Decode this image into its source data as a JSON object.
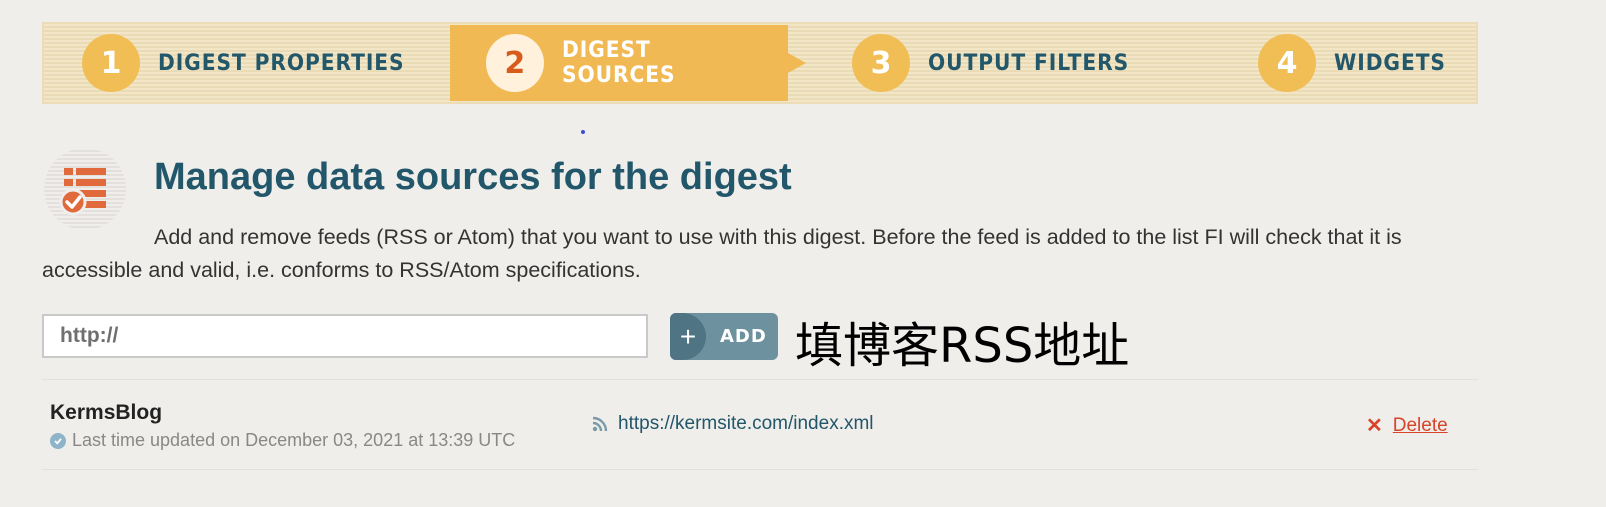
{
  "steps": [
    {
      "number": "1",
      "label": "DIGEST PROPERTIES"
    },
    {
      "number": "2",
      "label": "DIGEST SOURCES"
    },
    {
      "number": "3",
      "label": "OUTPUT FILTERS"
    },
    {
      "number": "4",
      "label": "WIDGETS"
    }
  ],
  "heading": {
    "title": "Manage data sources for the digest",
    "description": "Add and remove feeds (RSS or Atom) that you want to use with this digest. Before the feed is added to the list FI will check that it is accessible and valid, i.e. conforms to RSS/Atom specifications."
  },
  "add_form": {
    "placeholder": "http://",
    "value": "",
    "button_label": "ADD",
    "annotation": "填博客RSS地址"
  },
  "feeds": [
    {
      "name": "KermsBlog",
      "status": "Last time updated on December 03, 2021 at 13:39 UTC",
      "url": "https://kermsite.com/index.xml",
      "delete_label": "Delete"
    }
  ],
  "colors": {
    "accent": "#f1b953",
    "title": "#22566a",
    "delete": "#d8432a"
  }
}
